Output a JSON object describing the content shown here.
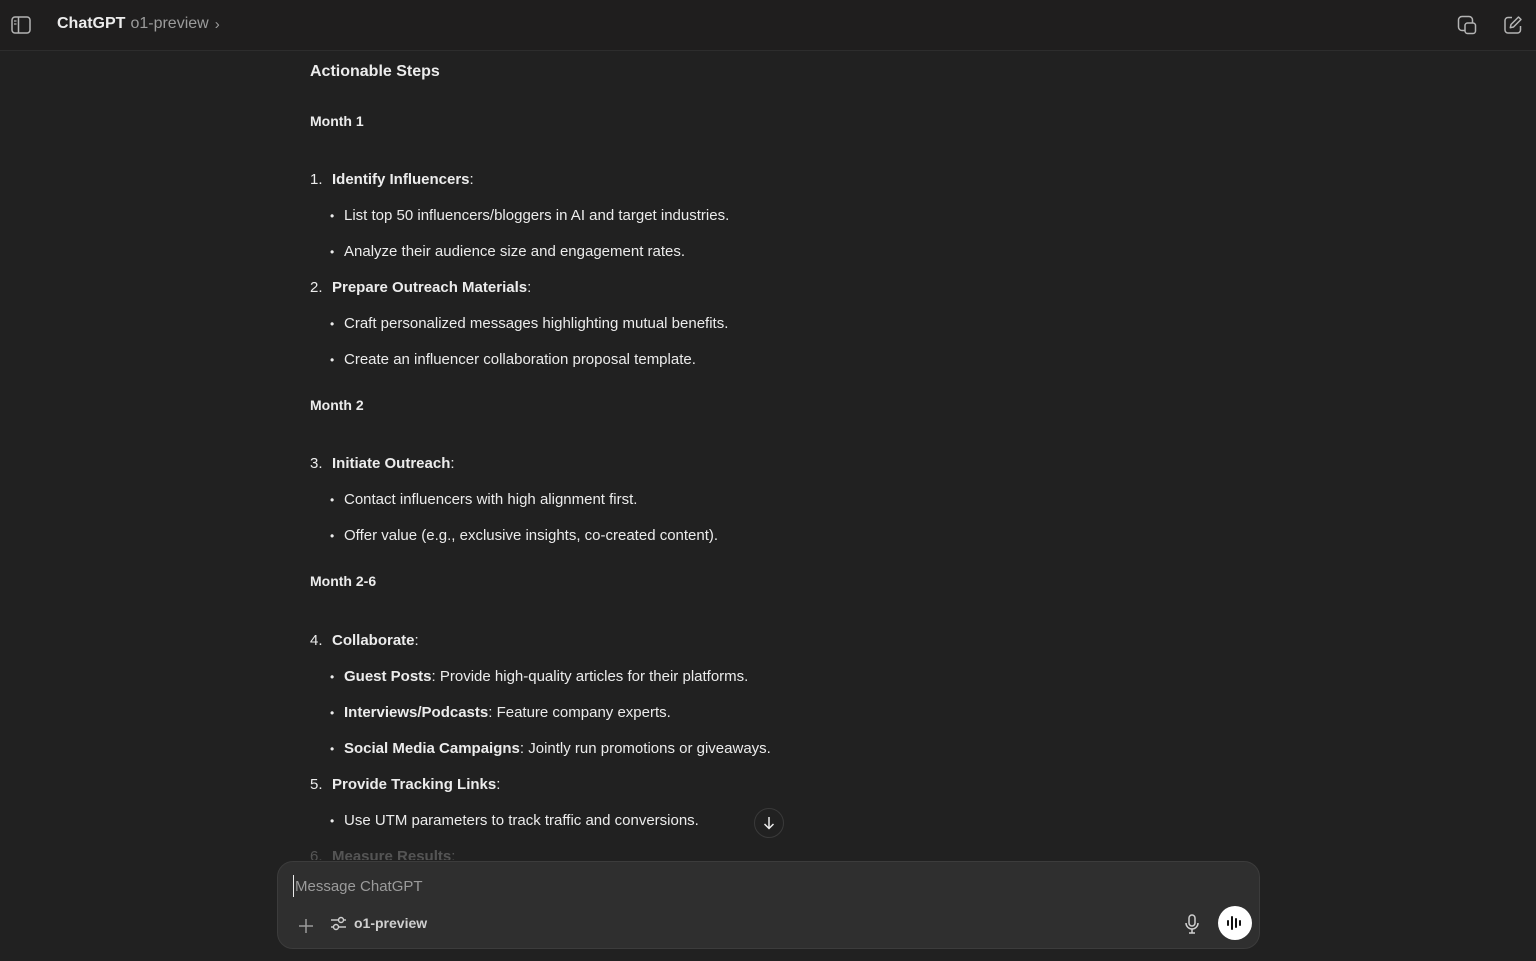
{
  "header": {
    "app_name": "ChatGPT",
    "model_name": "o1-preview",
    "chevron": "›"
  },
  "content": {
    "section_title": "Actionable Steps",
    "months": [
      "Month 1",
      "Month 2",
      "Month 2-6"
    ],
    "items": [
      {
        "num": "1.",
        "title": "Identify Influencers",
        "suffix": ":",
        "bullets": [
          {
            "bold": "",
            "text": "List top 50 influencers/bloggers in AI and target industries."
          },
          {
            "bold": "",
            "text": "Analyze their audience size and engagement rates."
          }
        ]
      },
      {
        "num": "2.",
        "title": "Prepare Outreach Materials",
        "suffix": ":",
        "bullets": [
          {
            "bold": "",
            "text": "Craft personalized messages highlighting mutual benefits."
          },
          {
            "bold": "",
            "text": "Create an influencer collaboration proposal template."
          }
        ]
      },
      {
        "num": "3.",
        "title": "Initiate Outreach",
        "suffix": ":",
        "bullets": [
          {
            "bold": "",
            "text": "Contact influencers with high alignment first."
          },
          {
            "bold": "",
            "text": "Offer value (e.g., exclusive insights, co-created content)."
          }
        ]
      },
      {
        "num": "4.",
        "title": "Collaborate",
        "suffix": ":",
        "bullets": [
          {
            "bold": "Guest Posts",
            "text": ": Provide high-quality articles for their platforms."
          },
          {
            "bold": "Interviews/Podcasts",
            "text": ": Feature company experts."
          },
          {
            "bold": "Social Media Campaigns",
            "text": ": Jointly run promotions or giveaways."
          }
        ]
      },
      {
        "num": "5.",
        "title": "Provide Tracking Links",
        "suffix": ":",
        "bullets": [
          {
            "bold": "",
            "text": "Use UTM parameters to track traffic and conversions."
          }
        ]
      },
      {
        "num": "6.",
        "title": "Measure Results",
        "suffix": ":",
        "bullets": []
      }
    ]
  },
  "composer": {
    "placeholder": "Message ChatGPT",
    "model_label": "o1-preview"
  },
  "icons": {
    "sidebar_toggle": "sidebar-toggle-icon",
    "temporary_chat": "temporary-chat-icon",
    "new_chat": "new-chat-icon",
    "scroll_down": "arrow-down-icon",
    "attach": "plus-icon",
    "model_settings": "sliders-icon",
    "microphone": "microphone-icon",
    "voice_mode": "voice-wave-icon"
  }
}
